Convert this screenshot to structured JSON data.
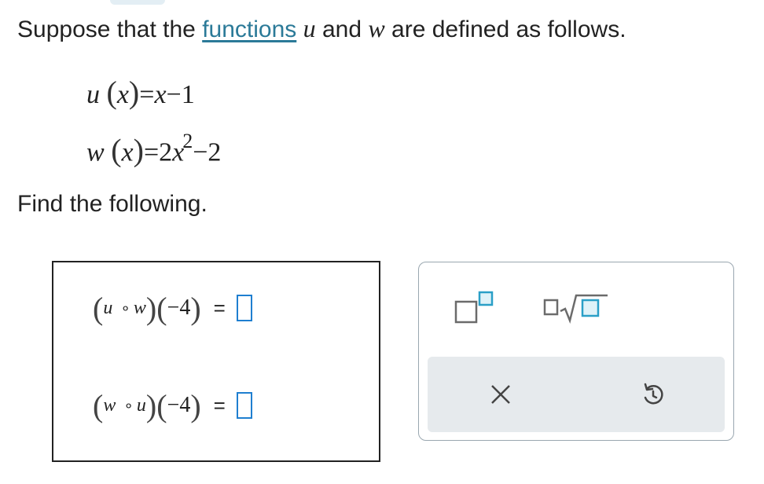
{
  "intro": {
    "prefix": "Suppose that the ",
    "link": "functions",
    "var_u": "u",
    "and": " and ",
    "var_w": "w",
    "suffix": " are defined as follows."
  },
  "equations": [
    {
      "name": "u",
      "lparen": "(",
      "arg": "x",
      "rparen": ")",
      "rhs_var": "x",
      "rhs_op": "=",
      "rhs_minus": "−",
      "rhs_const": "1"
    },
    {
      "name": "w",
      "lparen": "(",
      "arg": "x",
      "rparen": ")",
      "rhs_op": "=",
      "rhs_coef": "2",
      "rhs_var": "x",
      "rhs_exp": "2",
      "rhs_minus": "−",
      "rhs_const": "2"
    }
  ],
  "prompt": "Find the following.",
  "answers": [
    {
      "f": "u",
      "comp": "∘",
      "g": "w",
      "lparen": "(",
      "rparen": ")",
      "arg": "−4",
      "eq": "="
    },
    {
      "f": "w",
      "comp": "∘",
      "g": "u",
      "lparen": "(",
      "rparen": ")",
      "arg": "−4",
      "eq": "="
    }
  ],
  "toolbar": {
    "exponent_icon": "exponent-template-icon",
    "sqrt_icon": "square-root-template-icon",
    "clear_icon": "clear-x-icon",
    "undo_icon": "undo-icon"
  },
  "colors": {
    "link": "#2b7a98",
    "slot_border": "#1f7fd0",
    "toolbar_accent": "#2a9fc7",
    "toolbar_bg": "#e6eaed"
  }
}
